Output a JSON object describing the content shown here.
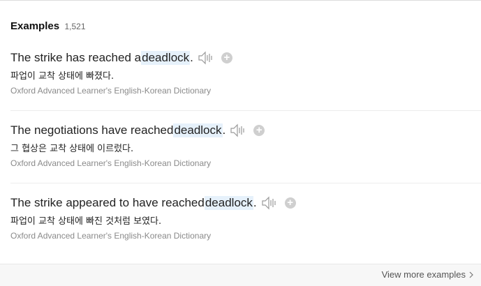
{
  "header": {
    "title": "Examples",
    "count": "1,521"
  },
  "examples": [
    {
      "before": "The strike has reached a ",
      "keyword": "deadlock",
      "after": ".",
      "translation": "파업이 교착 상태에 빠졌다.",
      "source": "Oxford Advanced Learner's English-Korean Dictionary"
    },
    {
      "before": "The negotiations have reached ",
      "keyword": "deadlock",
      "after": ".",
      "translation": "그 협상은 교착 상태에 이르렀다.",
      "source": "Oxford Advanced Learner's English-Korean Dictionary"
    },
    {
      "before": "The strike appeared to have reached ",
      "keyword": "deadlock",
      "after": ".",
      "translation": "파업이 교착 상태에 빠진 것처럼 보였다.",
      "source": "Oxford Advanced Learner's English-Korean Dictionary"
    }
  ],
  "icons": {
    "speaker": "speaker-icon",
    "add": "plus-circle-icon",
    "chevron": "chevron-right-icon"
  },
  "footer": {
    "view_more_label": "View more examples"
  },
  "colors": {
    "highlight": "#e6f1fb",
    "source_text": "#8a8a8a",
    "footer_bg": "#f7f7f7"
  }
}
